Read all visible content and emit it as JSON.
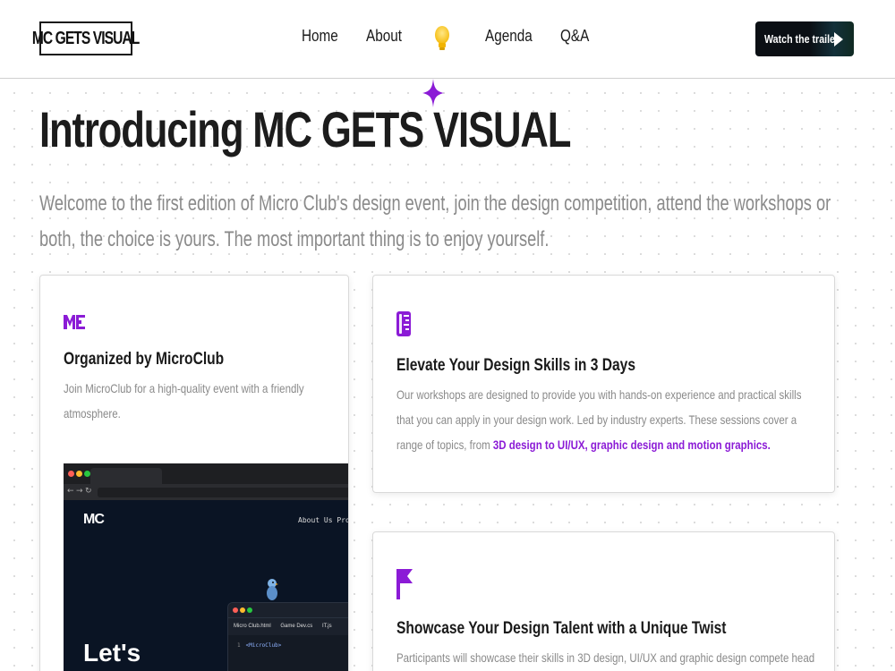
{
  "header": {
    "logo_text": "MC GETS VISUAL",
    "nav": [
      {
        "label": "Home"
      },
      {
        "label": "About"
      },
      {
        "label": "Agenda"
      },
      {
        "label": "Q&A"
      }
    ],
    "center_icon": "lightbulb-icon",
    "cta_label": "Watch the trailer",
    "cta_icon": "play-icon"
  },
  "hero": {
    "title": "Introducing MC GETS VISUAL",
    "subtitle": "Welcome to the first edition of Micro Club's design event, join the design competition, attend the workshops or both, the choice is yours. The most important thing is to enjoy yourself.",
    "decor_icon": "sparkle-icon"
  },
  "cards": [
    {
      "icon": "microclub-logo-icon",
      "title": "Organized by MicroClub",
      "text": "Join MicroClub for a high-quality event with a friendly atmosphere.",
      "preview": {
        "logo": "MC",
        "nav": "About Us  Projects",
        "headline": "Let's",
        "editor_tabs": [
          "Micro Club.html",
          "Game Dev.cs",
          "IT.js"
        ],
        "code_line_no": "1",
        "code": "<MicroClub>"
      }
    },
    {
      "icon": "ruler-icon",
      "title": "Elevate Your Design Skills in 3 Days",
      "text": "Our workshops are designed to provide you with hands-on experience and practical skills that you can apply in your design work. Led by industry experts. These sessions cover a range of topics, from",
      "highlight": "3D design to UI/UX, graphic design and motion graphics."
    },
    {
      "icon": "flag-icon",
      "title": "Showcase Your Design Talent with a Unique Twist",
      "text": "Participants will showcase their skills in 3D design, UI/UX and graphic design compete head to"
    }
  ],
  "colors": {
    "accent": "#8b1bd6",
    "text": "#1a1a1a",
    "muted": "#8a8a8a",
    "button_bg": "#0b0f14"
  }
}
